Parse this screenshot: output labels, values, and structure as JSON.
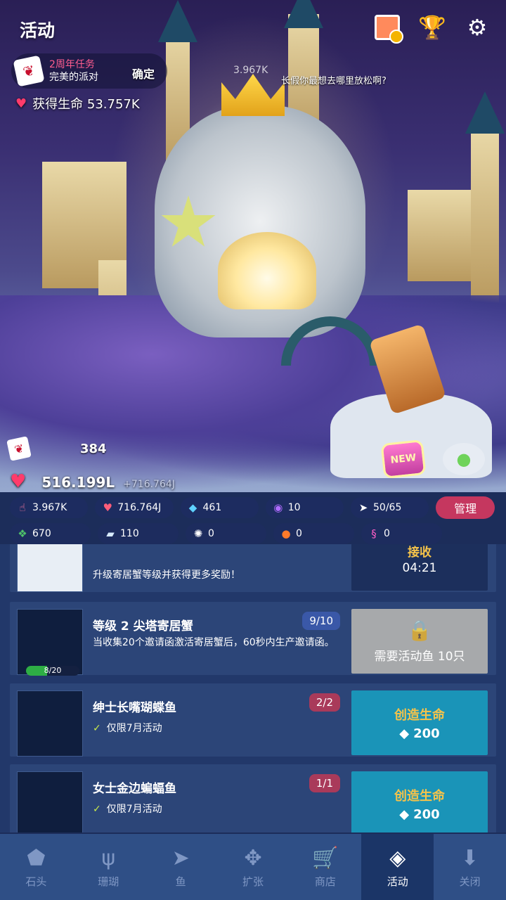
{
  "header": {
    "title": "活动",
    "icons": [
      "photo-ribbon-icon",
      "trophy-icon",
      "gear-icon"
    ]
  },
  "mission": {
    "line1": "2周年任务",
    "line2": "完美的派对",
    "confirm": "确定"
  },
  "life_gain": {
    "text": "获得生命 53.757K"
  },
  "floating": {
    "value": "3.967K",
    "question": "长假你最想去哪里放松啊?"
  },
  "stats": {
    "invites": "384",
    "life": "516.199L",
    "life_rate": "+716.764J"
  },
  "resources_row1": [
    {
      "icon": "tap-icon",
      "value": "3.967K"
    },
    {
      "icon": "heart-rate-icon",
      "value": "716.764J"
    },
    {
      "icon": "diamond-icon",
      "value": "461"
    },
    {
      "icon": "purple-token-icon",
      "value": "10"
    },
    {
      "icon": "fish-count-icon",
      "value": "50/65"
    }
  ],
  "manage_label": "管理",
  "resources_row2": [
    {
      "icon": "green-gem-icon",
      "value": "670"
    },
    {
      "icon": "ice-icon",
      "value": "110"
    },
    {
      "icon": "shell-icon",
      "value": "0"
    },
    {
      "icon": "orange-orb-icon",
      "value": "0"
    },
    {
      "icon": "seahorse-icon",
      "value": "0"
    }
  ],
  "list": {
    "row0": {
      "desc": "升级寄居蟹等级并获得更多奖励！",
      "action_label": "接收",
      "timer": "04:21"
    },
    "row1": {
      "title": "等级 2 尖塔寄居蟹",
      "badge": "9/10",
      "desc": "当收集20个邀请函激活寄居蟹后，60秒内生产邀请函。",
      "progress": "8/20",
      "progress_fraction": 0.4,
      "action_label": "需要活动鱼 10只"
    },
    "row2": {
      "title": "绅士长嘴瑚蝶鱼",
      "badge": "2/2",
      "note": "仅限7月活动",
      "action_label": "创造生命",
      "cost": "200"
    },
    "row3": {
      "title": "女士金边蝙蝠鱼",
      "badge": "1/1",
      "note": "仅限7月活动",
      "action_label": "创造生命",
      "cost": "200"
    }
  },
  "tabs": [
    {
      "label": "石头",
      "icon": "stone-icon"
    },
    {
      "label": "珊瑚",
      "icon": "coral-icon"
    },
    {
      "label": "鱼",
      "icon": "fish-icon"
    },
    {
      "label": "扩张",
      "icon": "expand-icon"
    },
    {
      "label": "商店",
      "icon": "cart-icon"
    },
    {
      "label": "活动",
      "icon": "event-icon",
      "active": true
    },
    {
      "label": "关闭",
      "icon": "close-down-icon"
    }
  ],
  "colors": {
    "accent_teal": "#1a94b8",
    "manage_red": "#c5375f",
    "gold_text": "#f6c34a",
    "tab_bg": "#2f4f86",
    "list_bg": "#22386a"
  }
}
